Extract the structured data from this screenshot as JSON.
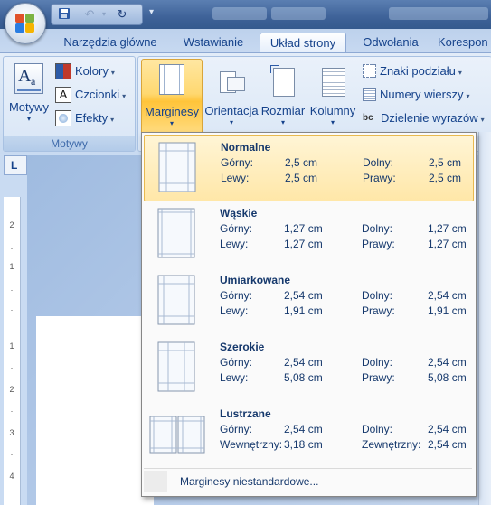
{
  "quick_access": {
    "icons": [
      "save-icon",
      "undo-icon",
      "redo-icon"
    ]
  },
  "tabs": [
    {
      "label": "Narzędzia główne",
      "active": false
    },
    {
      "label": "Wstawianie",
      "active": false
    },
    {
      "label": "Układ strony",
      "active": true
    },
    {
      "label": "Odwołania",
      "active": false
    },
    {
      "label": "Korespon",
      "active": false
    }
  ],
  "ribbon": {
    "themes_group": {
      "label": "Motywy",
      "themes_button": "Motywy",
      "colors": "Kolory",
      "fonts": "Czcionki",
      "effects": "Efekty"
    },
    "page_setup": {
      "margins": "Marginesy",
      "orientation": "Orientacja",
      "size": "Rozmiar",
      "columns": "Kolumny",
      "breaks": "Znaki podziału",
      "line_numbers": "Numery wierszy",
      "hyphenation": "Dzielenie wyrazów"
    }
  },
  "ruler": {
    "corner_symbol": "L",
    "labels": [
      "2",
      "1",
      "1",
      "2",
      "3",
      "4"
    ]
  },
  "margins_menu": {
    "items": [
      {
        "title": "Normalne",
        "r1_l_label": "Górny:",
        "r1_l_val": "2,5 cm",
        "r1_r_label": "Dolny:",
        "r1_r_val": "2,5 cm",
        "r2_l_label": "Lewy:",
        "r2_l_val": "2,5 cm",
        "r2_r_label": "Prawy:",
        "r2_r_val": "2,5 cm",
        "selected": true
      },
      {
        "title": "Wąskie",
        "r1_l_label": "Górny:",
        "r1_l_val": "1,27 cm",
        "r1_r_label": "Dolny:",
        "r1_r_val": "1,27 cm",
        "r2_l_label": "Lewy:",
        "r2_l_val": "1,27 cm",
        "r2_r_label": "Prawy:",
        "r2_r_val": "1,27 cm",
        "selected": false
      },
      {
        "title": "Umiarkowane",
        "r1_l_label": "Górny:",
        "r1_l_val": "2,54 cm",
        "r1_r_label": "Dolny:",
        "r1_r_val": "2,54 cm",
        "r2_l_label": "Lewy:",
        "r2_l_val": "1,91 cm",
        "r2_r_label": "Prawy:",
        "r2_r_val": "1,91 cm",
        "selected": false
      },
      {
        "title": "Szerokie",
        "r1_l_label": "Górny:",
        "r1_l_val": "2,54 cm",
        "r1_r_label": "Dolny:",
        "r1_r_val": "2,54 cm",
        "r2_l_label": "Lewy:",
        "r2_l_val": "5,08 cm",
        "r2_r_label": "Prawy:",
        "r2_r_val": "5,08 cm",
        "selected": false
      },
      {
        "title": "Lustrzane",
        "r1_l_label": "Górny:",
        "r1_l_val": "2,54 cm",
        "r1_r_label": "Dolny:",
        "r1_r_val": "2,54 cm",
        "r2_l_label": "Wewnętrzny:",
        "r2_l_val": "3,18 cm",
        "r2_r_label": "Zewnętrzny:",
        "r2_r_val": "2,54 cm",
        "selected": false
      }
    ],
    "custom": "Marginesy niestandardowe..."
  }
}
